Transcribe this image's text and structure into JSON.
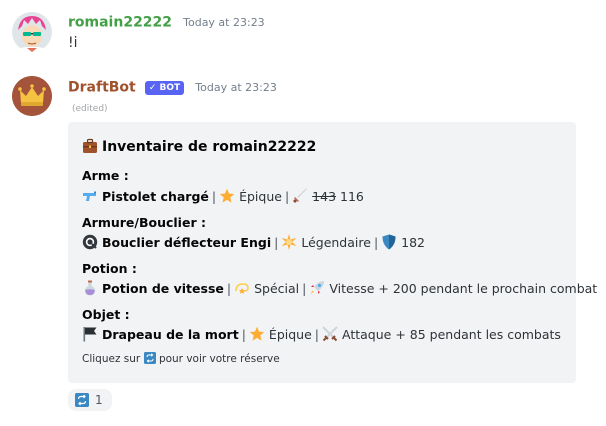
{
  "message1": {
    "username": "romain22222",
    "timestamp": "Today at 23:23",
    "content": "!i",
    "name_color": "#43a047"
  },
  "message2": {
    "username": "DraftBot",
    "bot_tag": "✓ BOT",
    "timestamp": "Today at 23:23",
    "edited": "(edited)",
    "name_color": "#a0522d"
  },
  "embed": {
    "title": "Inventaire de romain22222",
    "fields": [
      {
        "name": "Arme :",
        "item": "Pistolet chargé",
        "rarity": "Épique",
        "old_stat": "143",
        "new_stat": "116"
      },
      {
        "name": "Armure/Bouclier :",
        "item": "Bouclier déflecteur Engi",
        "rarity": "Légendaire",
        "stat": "182"
      },
      {
        "name": "Potion :",
        "item": "Potion de vitesse",
        "rarity": "Spécial",
        "effect": "Vitesse + 200 pendant le prochain combat"
      },
      {
        "name": "Objet :",
        "item": "Drapeau de la mort",
        "rarity": "Épique",
        "effect": "Attaque + 85 pendant les combats"
      }
    ],
    "footer_prefix": "Cliquez sur",
    "footer_suffix": "pour voir votre réserve"
  },
  "reaction": {
    "emoji": "repeat-icon",
    "count": "1"
  }
}
